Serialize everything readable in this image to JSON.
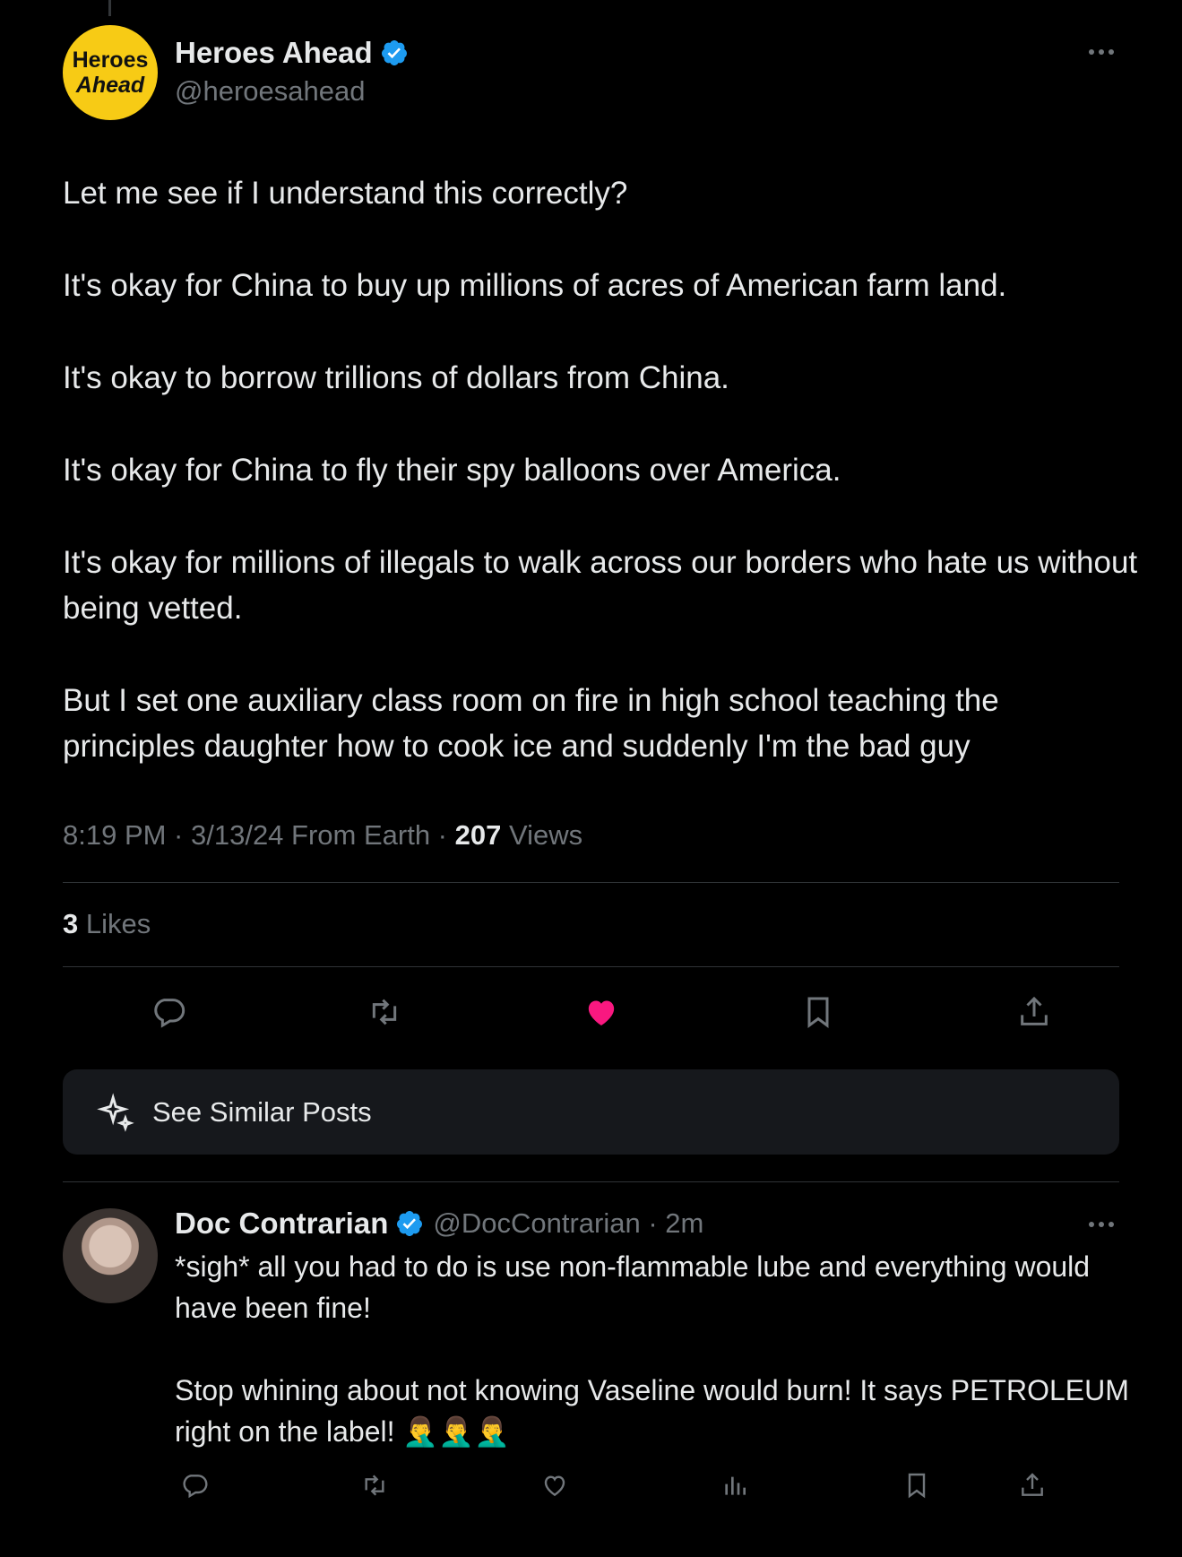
{
  "main_post": {
    "author": {
      "avatar_line1": "Heroes",
      "avatar_line2": "Ahead",
      "display_name": "Heroes Ahead",
      "handle": "@heroesahead",
      "verified": true
    },
    "body": [
      "Let me see if I understand this correctly?",
      "It's okay for China to buy up millions of acres of American farm land.",
      "It's okay to borrow trillions of dollars from China.",
      "It's okay for China to fly their spy balloons over America.",
      "It's okay for millions of illegals to walk across our borders who hate us without being vetted.",
      "But I set one auxiliary class room on fire in high school teaching the principles daughter how to cook ice and suddenly I'm the bad guy"
    ],
    "meta": {
      "time_date": "8:19 PM · 3/13/24 From Earth · ",
      "views_count": "207",
      "views_label": " Views"
    },
    "likes": {
      "count": "3",
      "label": " Likes"
    },
    "liked": true,
    "like_color": "#f91880"
  },
  "see_similar": {
    "label": "See Similar Posts"
  },
  "reply": {
    "display_name": "Doc Contrarian",
    "handle_time": "@DocContrarian · 2m",
    "verified": true,
    "body": [
      "*sigh* all you had to do is use non-flammable lube and everything would have been fine!",
      "Stop whining about not knowing Vaseline would burn! It says PETROLEUM right on the label! 🤦‍♂️🤦‍♂️🤦‍♂️"
    ]
  },
  "colors": {
    "accent": "#1d9bf0",
    "muted": "#71767b",
    "text": "#e7e9ea",
    "background": "#000000"
  },
  "icons": [
    "reply-icon",
    "retweet-icon",
    "heart-icon",
    "bookmark-icon",
    "share-icon",
    "sparkle-icon",
    "views-icon",
    "verified-badge-icon",
    "more-icon"
  ]
}
